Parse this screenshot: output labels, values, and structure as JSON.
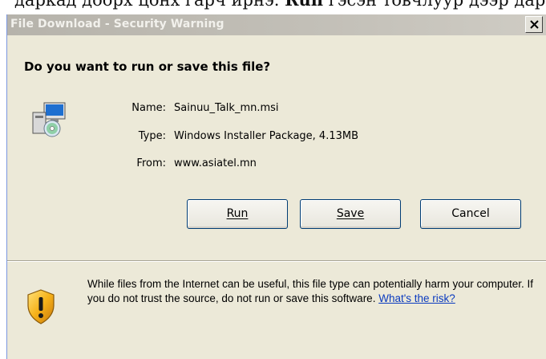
{
  "background_text": {
    "normal": "даркад доорх цонх гарч ирнэ. ",
    "bold": "Run",
    "rest": " гэсэн товчлуур дээр дарна."
  },
  "dialog": {
    "title": "File Download - Security Warning",
    "close_glyph": "×",
    "question": "Do you want to run or save this file?",
    "file_icon": "installer-package-icon",
    "fields": {
      "name_label": "Name:",
      "name_value": "Sainuu_Talk_mn.msi",
      "type_label": "Type:",
      "type_value": "Windows Installer Package, 4.13MB",
      "from_label": "From:",
      "from_value": "www.asiatel.mn"
    },
    "buttons": {
      "run": "Run",
      "save": "Save",
      "cancel": "Cancel"
    },
    "warning": {
      "icon": "shield-warning-icon",
      "text": "While files from the Internet can be useful, this file type can potentially harm your computer. If you do not trust the source, do not run or save this software. ",
      "link": "What's the risk?"
    }
  },
  "colors": {
    "dialog_bg": "#ece9d8",
    "titlebar": "#c3c0b8",
    "link": "#0b3bbf"
  }
}
